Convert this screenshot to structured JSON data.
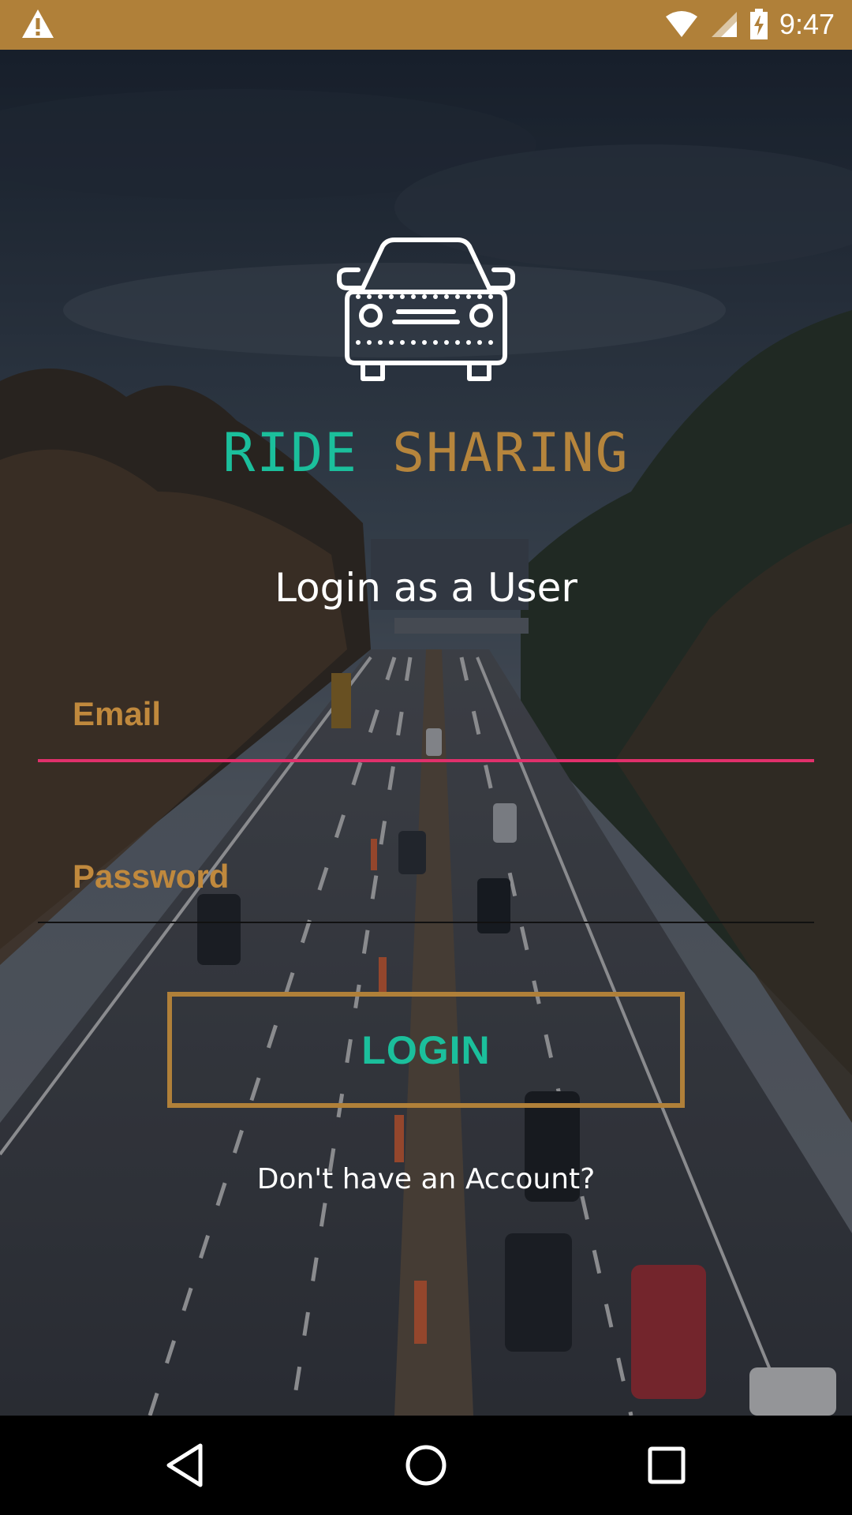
{
  "status_bar": {
    "time": "9:47",
    "icons": [
      "warning-icon",
      "wifi-icon",
      "signal-icon",
      "battery-charging-icon"
    ],
    "background": "#b08039"
  },
  "app": {
    "title_part1": "RIDE",
    "title_part2": "SHARING",
    "subtitle": "Login as a User"
  },
  "form": {
    "email_placeholder": "Email",
    "password_placeholder": "Password",
    "login_label": "LOGIN",
    "signup_link": "Don't have an Account?"
  },
  "colors": {
    "accent_gold": "#b08039",
    "accent_teal": "#1bbf9c",
    "focus_underline": "#e0306b"
  },
  "nav_bar": {
    "icons": [
      "back-icon",
      "home-icon",
      "recents-icon"
    ]
  }
}
